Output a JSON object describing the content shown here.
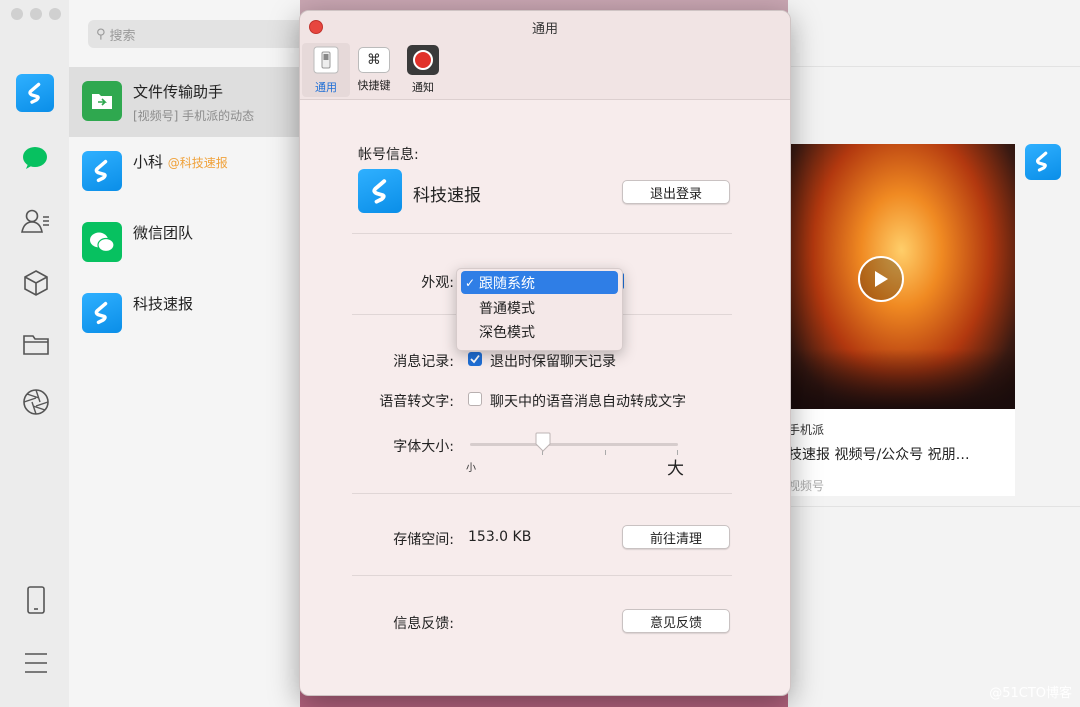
{
  "search": {
    "placeholder": "搜索"
  },
  "chats": [
    {
      "name": "文件传输助手",
      "preview": "[视频号] 手机派的动态"
    },
    {
      "name": "小科",
      "tag": "@科技速报"
    },
    {
      "name": "微信团队"
    },
    {
      "name": "科技速报"
    }
  ],
  "window": {
    "title": "通用",
    "tabs": [
      {
        "label": "通用",
        "icon": "switch-icon"
      },
      {
        "label": "快捷键",
        "icon": "command-key-icon"
      },
      {
        "label": "通知",
        "icon": "record-icon"
      }
    ]
  },
  "account": {
    "section_label": "帐号信息:",
    "name": "科技速报",
    "logout_label": "退出登录"
  },
  "appearance": {
    "label": "外观:",
    "options": [
      "跟随系统",
      "普通模式",
      "深色模式"
    ],
    "selected": "跟随系统"
  },
  "history": {
    "label": "消息记录:",
    "checkbox_label": "退出时保留聊天记录",
    "checked": true
  },
  "voice": {
    "label": "语音转文字:",
    "checkbox_label": "聊天中的语音消息自动转成文字",
    "checked": false
  },
  "font_size": {
    "label": "字体大小:",
    "min_label": "小",
    "max_label": "大",
    "value_fraction": 0.35
  },
  "storage": {
    "label": "存储空间:",
    "value": "153.0 KB",
    "clean_label": "前往清理"
  },
  "feedback": {
    "label": "信息反馈:",
    "button_label": "意见反馈"
  },
  "moment_card": {
    "author": "手机派",
    "title": "技速报 视频号/公众号 祝朋…",
    "source": "视频号"
  },
  "watermark": "@51CTO博客",
  "colors": {
    "accent": "#1f6fd6",
    "wechat_green": "#07c160",
    "brand_blue": "#1a9bf0",
    "close_red": "#e7463f"
  }
}
